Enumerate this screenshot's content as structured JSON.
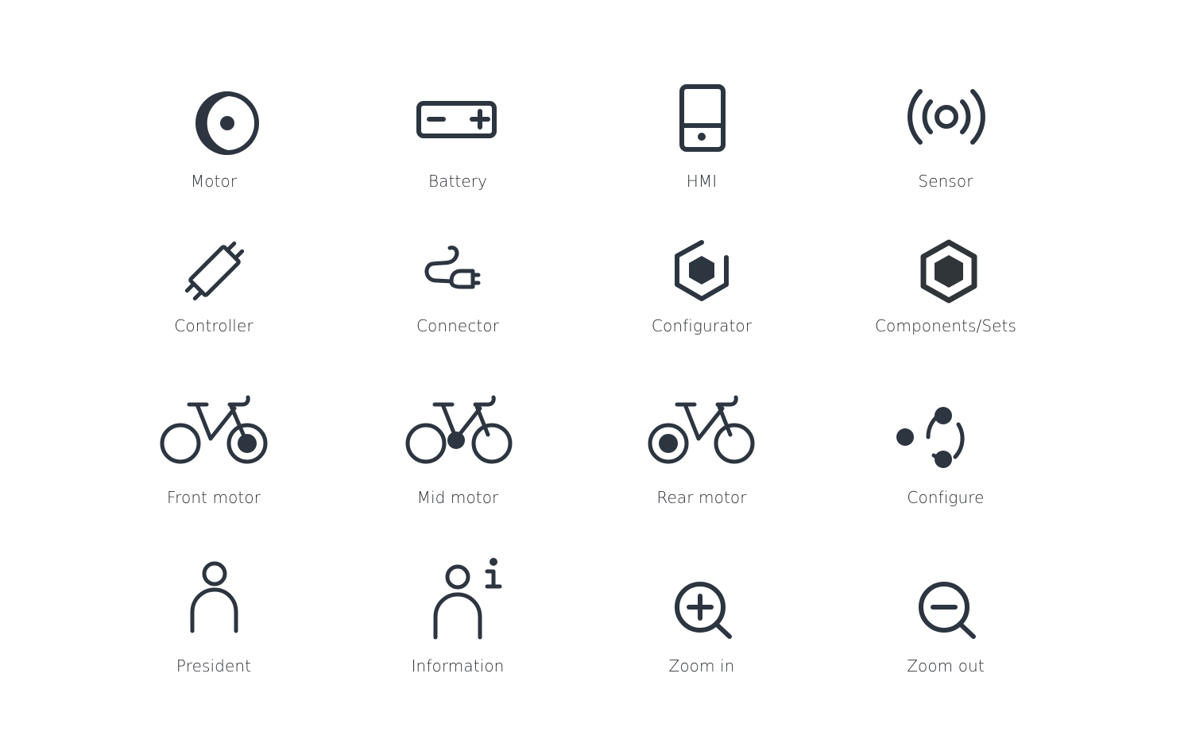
{
  "colors": {
    "icon": "#2c3540",
    "label": "#2b2f33",
    "background": "#ffffff"
  },
  "rows": [
    [
      {
        "id": "motor",
        "label": "Motor",
        "icon": "motor-icon"
      },
      {
        "id": "battery",
        "label": "Battery",
        "icon": "battery-icon"
      },
      {
        "id": "hmi",
        "label": "HMI",
        "icon": "hmi-display-icon"
      },
      {
        "id": "sensor",
        "label": "Sensor",
        "icon": "sensor-icon"
      }
    ],
    [
      {
        "id": "controller",
        "label": "Controller",
        "icon": "controller-icon"
      },
      {
        "id": "connector",
        "label": "Connector",
        "icon": "connector-plug-icon"
      },
      {
        "id": "configurator",
        "label": "Configurator",
        "icon": "configurator-hexagon-icon"
      },
      {
        "id": "components-sets",
        "label": "Components/Sets",
        "icon": "components-hexagon-icon"
      }
    ],
    [
      {
        "id": "front-motor",
        "label": "Front motor",
        "icon": "bike-front-motor-icon"
      },
      {
        "id": "mid-motor",
        "label": "Mid motor",
        "icon": "bike-mid-motor-icon"
      },
      {
        "id": "rear-motor",
        "label": "Rear motor",
        "icon": "bike-rear-motor-icon"
      },
      {
        "id": "configure",
        "label": "Configure",
        "icon": "configure-nodes-icon"
      }
    ],
    [
      {
        "id": "president",
        "label": "President",
        "icon": "person-icon"
      },
      {
        "id": "information",
        "label": "Information",
        "icon": "person-info-icon"
      },
      {
        "id": "zoom-in",
        "label": "Zoom in",
        "icon": "zoom-in-icon"
      },
      {
        "id": "zoom-out",
        "label": "Zoom out",
        "icon": "zoom-out-icon"
      }
    ]
  ]
}
